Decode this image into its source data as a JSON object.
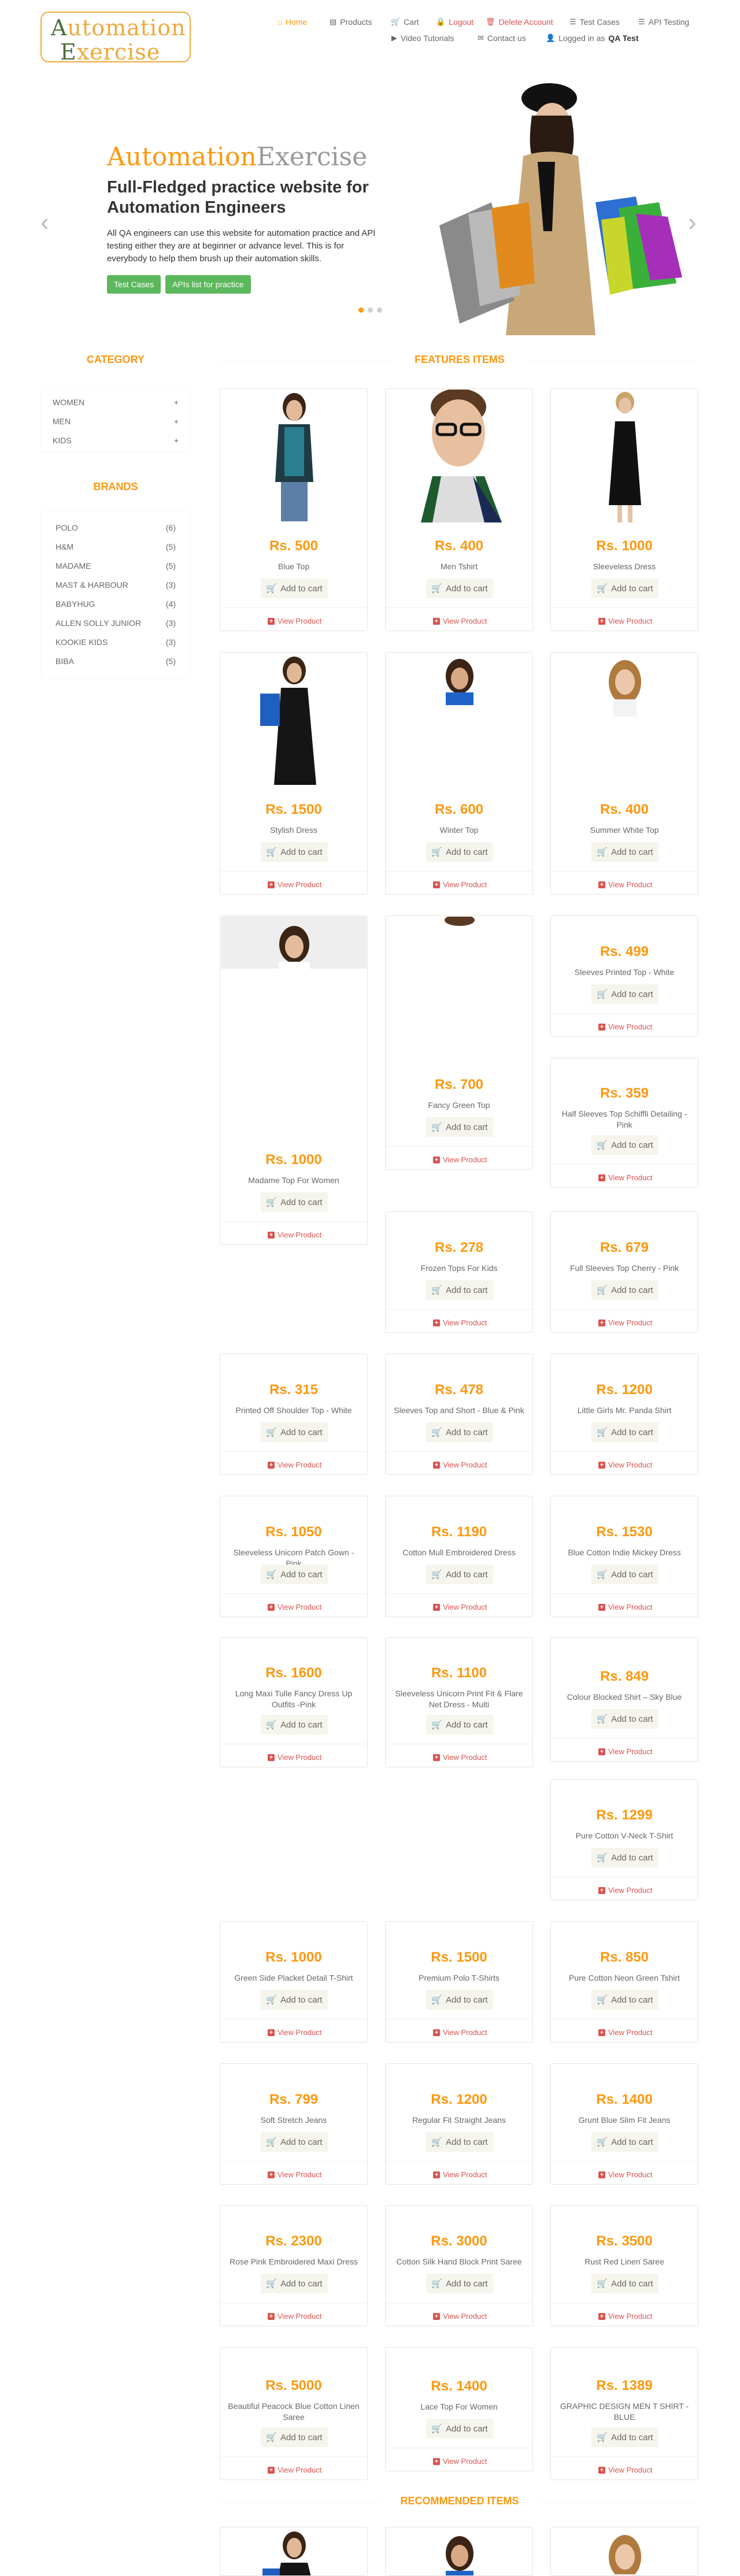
{
  "logo": {
    "line1_cap": "A",
    "line1": "utomation",
    "line2_cap": "E",
    "line2": "xercise"
  },
  "nav": {
    "home": "Home",
    "products": "Products",
    "cart": "Cart",
    "logout": "Logout",
    "delete_account": "Delete Account",
    "test_cases": "Test Cases",
    "api_testing": "API Testing",
    "video_tutorials": "Video Tutorials",
    "contact_us": "Contact us",
    "logged_in_prefix": "Logged in as",
    "logged_in_user": "QA Test"
  },
  "slider": {
    "brand_a": "Automation",
    "brand_b": "Exercise",
    "heading": "Full-Fledged practice website for Automation Engineers",
    "text": "All QA engineers can use this website for automation practice and API testing either they are at beginner or advance level. This is for everybody to help them brush up their automation skills.",
    "btn_test_cases": "Test Cases",
    "btn_apis": "APIs list for practice",
    "prev": "‹",
    "next": "›"
  },
  "sidebar": {
    "category_title": "Category",
    "categories": [
      {
        "label": "Women",
        "toggle": "+"
      },
      {
        "label": "Men",
        "toggle": "+"
      },
      {
        "label": "Kids",
        "toggle": "+"
      }
    ],
    "brands_title": "Brands",
    "brands": [
      {
        "label": "Polo",
        "count": "(6)"
      },
      {
        "label": "H&M",
        "count": "(5)"
      },
      {
        "label": "Madame",
        "count": "(5)"
      },
      {
        "label": "Mast & Harbour",
        "count": "(3)"
      },
      {
        "label": "Babyhug",
        "count": "(4)"
      },
      {
        "label": "Allen Solly Junior",
        "count": "(3)"
      },
      {
        "label": "Kookie Kids",
        "count": "(3)"
      },
      {
        "label": "Biba",
        "count": "(5)"
      }
    ]
  },
  "features_title": "Features Items",
  "recommended_title": "Recommended Items",
  "common": {
    "add_to_cart": "Add to cart",
    "view_product": "View Product"
  },
  "products": [
    {
      "price": "Rs. 500",
      "name": "Blue Top"
    },
    {
      "price": "Rs. 400",
      "name": "Men Tshirt"
    },
    {
      "price": "Rs. 1000",
      "name": "Sleeveless Dress"
    },
    {
      "price": "Rs. 1500",
      "name": "Stylish Dress"
    },
    {
      "price": "Rs. 600",
      "name": "Winter Top"
    },
    {
      "price": "Rs. 400",
      "name": "Summer White Top"
    },
    {
      "price": "Rs. 1000",
      "name": "Madame Top For Women"
    },
    {
      "price": "Rs. 700",
      "name": "Fancy Green Top"
    },
    {
      "price": "Rs. 499",
      "name": "Sleeves Printed Top - White"
    },
    {
      "price": "Rs. 359",
      "name": "Half Sleeves Top Schiffli Detailing - Pink"
    },
    {
      "price": "Rs. 278",
      "name": "Frozen Tops For Kids"
    },
    {
      "price": "Rs. 679",
      "name": "Full Sleeves Top Cherry - Pink"
    },
    {
      "price": "Rs. 315",
      "name": "Printed Off Shoulder Top - White"
    },
    {
      "price": "Rs. 478",
      "name": "Sleeves Top and Short - Blue & Pink"
    },
    {
      "price": "Rs. 1200",
      "name": "Little Girls Mr. Panda Shirt"
    },
    {
      "price": "Rs. 1050",
      "name": "Sleeveless Unicorn Patch Gown - Pink"
    },
    {
      "price": "Rs. 1190",
      "name": "Cotton Mull Embroidered Dress"
    },
    {
      "price": "Rs. 1530",
      "name": "Blue Cotton Indie Mickey Dress"
    },
    {
      "price": "Rs. 1600",
      "name": "Long Maxi Tulle Fancy Dress Up Outfits -Pink"
    },
    {
      "price": "Rs. 1100",
      "name": "Sleeveless Unicorn Print Fit & Flare Net Dress - Multi"
    },
    {
      "price": "Rs. 849",
      "name": "Colour Blocked Shirt – Sky Blue"
    },
    {
      "price": "Rs. 1299",
      "name": "Pure Cotton V-Neck T-Shirt"
    },
    {
      "price": "Rs. 1000",
      "name": "Green Side Placket Detail T-Shirt"
    },
    {
      "price": "Rs. 1500",
      "name": "Premium Polo T-Shirts"
    },
    {
      "price": "Rs. 850",
      "name": "Pure Cotton Neon Green Tshirt"
    },
    {
      "price": "Rs. 799",
      "name": "Soft Stretch Jeans"
    },
    {
      "price": "Rs. 1200",
      "name": "Regular Fit Straight Jeans"
    },
    {
      "price": "Rs. 1400",
      "name": "Grunt Blue Slim Fit Jeans"
    },
    {
      "price": "Rs. 2300",
      "name": "Rose Pink Embroidered Maxi Dress"
    },
    {
      "price": "Rs. 3000",
      "name": "Cotton Silk Hand Block Print Saree"
    },
    {
      "price": "Rs. 3500",
      "name": "Rust Red Linen Saree"
    },
    {
      "price": "Rs. 5000",
      "name": "Beautiful Peacock Blue Cotton Linen Saree"
    },
    {
      "price": "Rs. 1400",
      "name": "Lace Top For Women"
    },
    {
      "price": "Rs. 1389",
      "name": "GRAPHIC DESIGN MEN T SHIRT - BLUE"
    }
  ],
  "colors": {
    "accent": "#FE980F",
    "green": "#5CB85C",
    "red": "#D9534F",
    "text": "#696763"
  },
  "icons": [
    "home-icon",
    "products-icon",
    "cart-icon",
    "lock-icon",
    "trash-icon",
    "list-icon",
    "youtube-icon",
    "envelope-icon",
    "user-icon",
    "plus-square-icon",
    "shopping-cart-icon"
  ]
}
